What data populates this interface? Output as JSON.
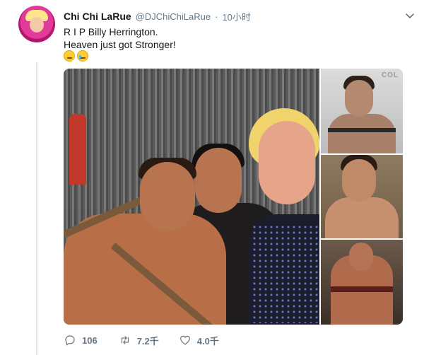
{
  "tweet": {
    "author": {
      "display_name": "Chi Chi LaRue",
      "handle": "@DJChiChiLaRue",
      "separator": "·",
      "time": "10小时"
    },
    "text_lines": [
      "R I P Billy Herrington.",
      "Heaven just got Stronger!"
    ],
    "emojis": [
      "relieved-face-emoji",
      "crying-face-emoji"
    ],
    "media": {
      "photos": [
        "main-group-photo",
        "portrait-photo-top",
        "portrait-photo-middle",
        "portrait-photo-bottom"
      ],
      "watermark": "COL"
    },
    "actions": {
      "reply_count": "106",
      "retweet_count": "7.2千",
      "like_count": "4.0千"
    }
  },
  "colors": {
    "text_primary": "#14171a",
    "text_secondary": "#657786",
    "thread_line": "#e1e8ed"
  },
  "icons": [
    "chevron-down-icon",
    "reply-icon",
    "retweet-icon",
    "like-icon"
  ]
}
